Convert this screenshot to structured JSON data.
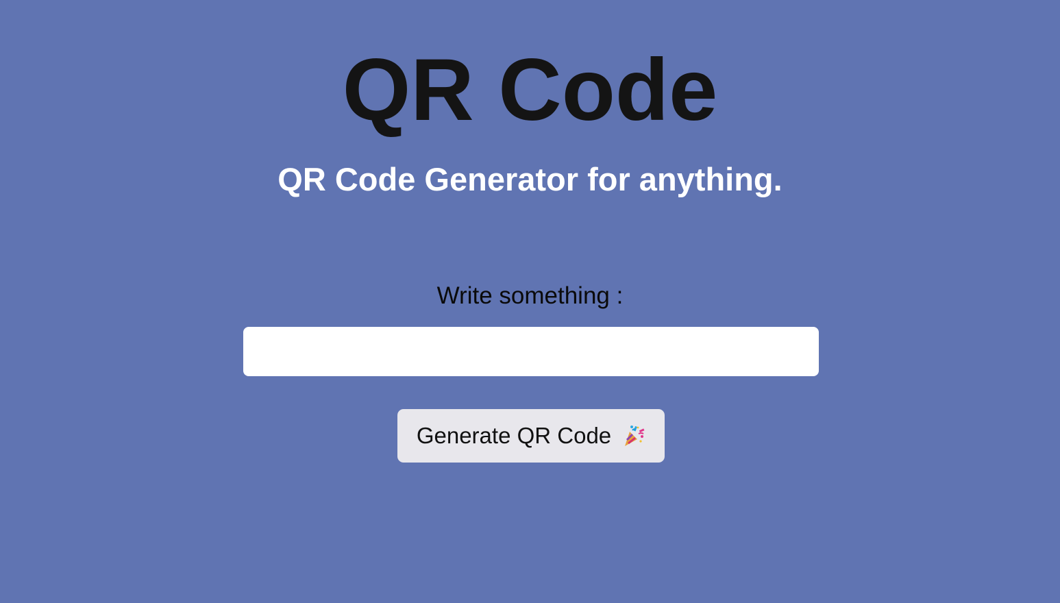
{
  "header": {
    "title": "QR Code",
    "subtitle": "QR Code Generator for anything."
  },
  "form": {
    "label": "Write something :",
    "input_value": "",
    "input_placeholder": "",
    "button_label": "Generate QR Code",
    "button_icon": "party-popper-icon"
  },
  "colors": {
    "background": "#6074b2",
    "title": "#141414",
    "subtitle": "#ffffff",
    "input_background": "#ffffff",
    "button_background": "#e8e7ec"
  }
}
